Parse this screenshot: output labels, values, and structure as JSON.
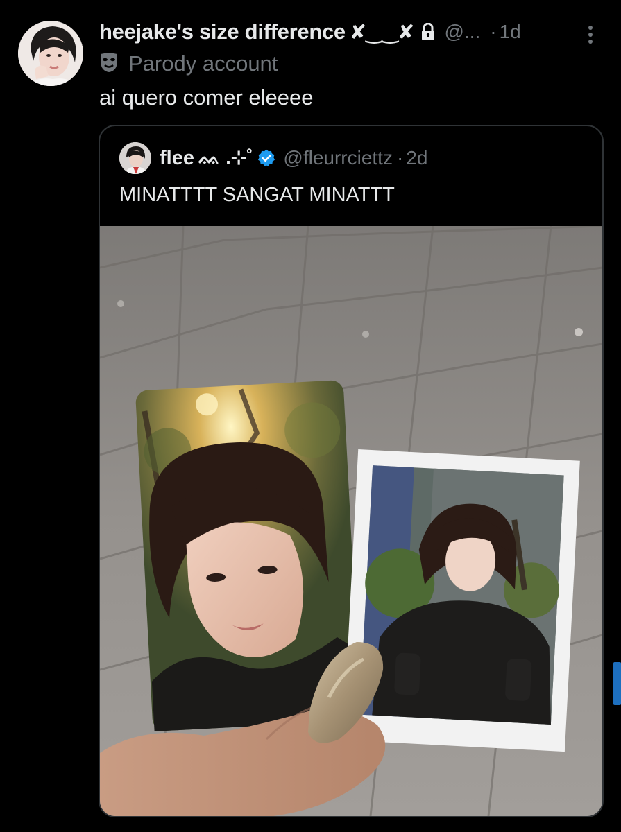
{
  "tweet": {
    "display_name": "heejake's size difference",
    "name_decoration": "✘‿‿✘",
    "handle": "@...",
    "separator": "·",
    "time": "1d",
    "account_label": "Parody account",
    "text": "ai quero comer eleeee",
    "icons": {
      "lock": "lock-icon",
      "more": "more-vertical-icon",
      "parody": "mask-icon"
    }
  },
  "quote": {
    "display_name": "flee",
    "name_decoration": "ᨐ .⊹˚",
    "verified": true,
    "handle": "@fleurrciettz",
    "separator": "·",
    "time": "2d",
    "text": "MINATTTT SANGAT MINATTT",
    "media": "photo: hand holding a photocard and a polaroid of a dark-haired man over stone pavement"
  },
  "colors": {
    "background": "#000000",
    "primary_text": "#e7e9ea",
    "secondary_text": "#71767b",
    "border": "#2f3336",
    "verified": "#1d9bf0"
  }
}
